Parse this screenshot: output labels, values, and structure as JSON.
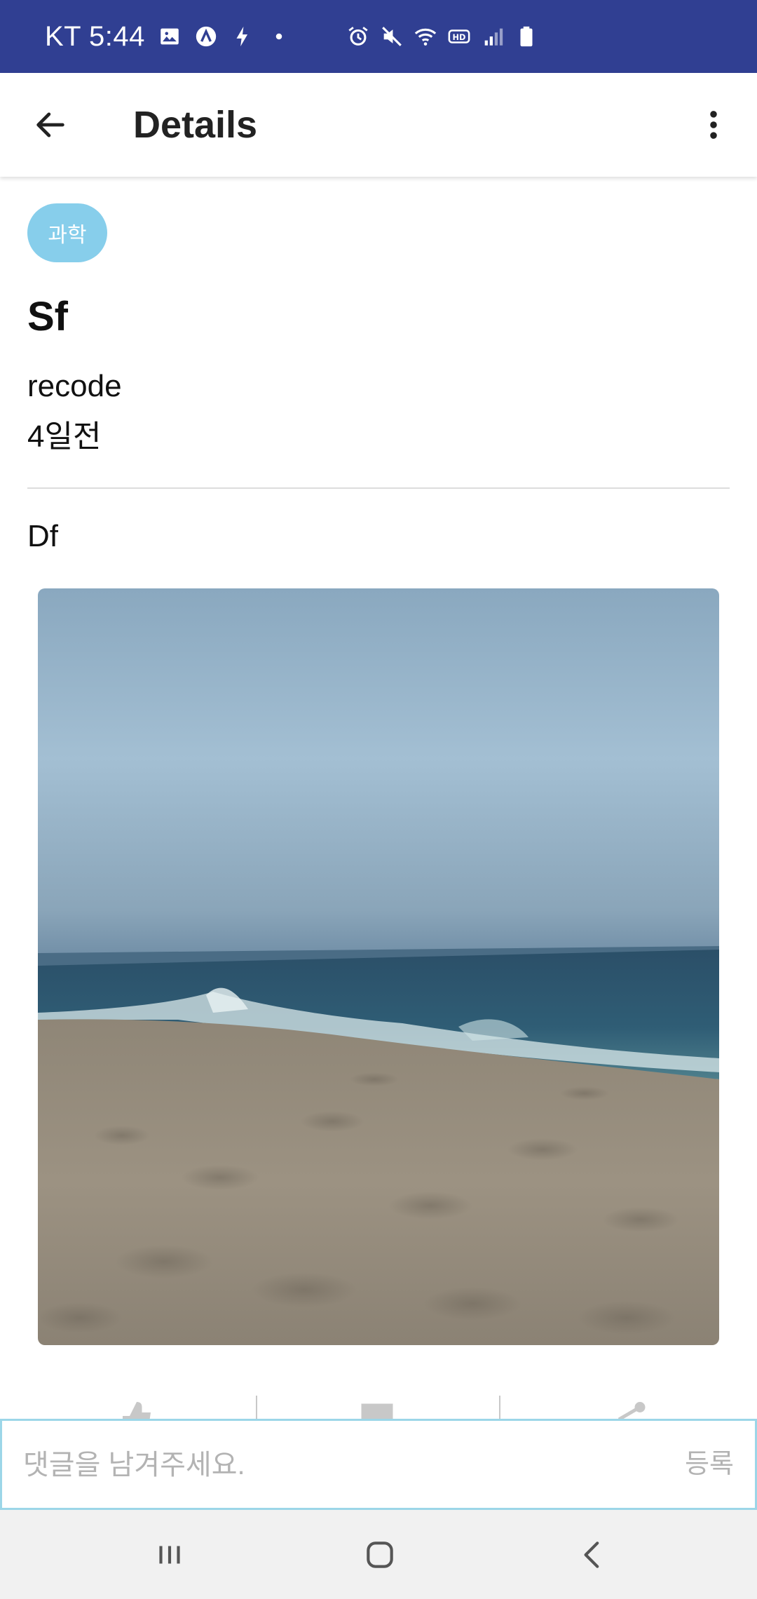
{
  "status_bar": {
    "carrier": "KT",
    "time": "5:44",
    "left_icons": [
      "gallery-icon",
      "a-icon",
      "bolt-icon",
      "dot-icon"
    ],
    "right_icons": [
      "alarm-icon",
      "mute-icon",
      "wifi-icon",
      "hd-icon",
      "signal-icon",
      "battery-icon"
    ]
  },
  "app_bar": {
    "title": "Details",
    "back_icon": "arrow-left-icon",
    "menu_icon": "more-vertical-icon"
  },
  "post": {
    "category": "과학",
    "title": "Sf",
    "author": "recode",
    "date": "4일전",
    "body": "Df",
    "image": "beach-photo"
  },
  "actions": {
    "icons": [
      "like-icon",
      "comment-icon",
      "share-icon"
    ]
  },
  "comment": {
    "placeholder": "댓글을 남겨주세요.",
    "value": "",
    "submit_label": "등록"
  },
  "nav_bar": {
    "icons": [
      "recent-apps-icon",
      "home-icon",
      "back-icon"
    ]
  },
  "colors": {
    "status_bar": "#303f92",
    "badge": "#87ceeb",
    "comment_border": "#9cd6e8",
    "nav_bar": "#f1f1f1"
  }
}
